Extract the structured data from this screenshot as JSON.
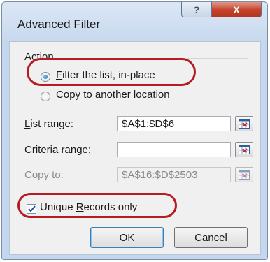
{
  "window": {
    "title": "Advanced Filter",
    "help_label": "?",
    "close_label": "X"
  },
  "action": {
    "group_label": "Action",
    "options": [
      {
        "mnemonic": "F",
        "rest": "ilter the list, in-place",
        "checked": true
      },
      {
        "mnemonic": "o",
        "prefix": "C",
        "rest": "py to another location",
        "checked": false
      }
    ]
  },
  "fields": {
    "list_range": {
      "mnemonic": "L",
      "rest": "ist range:",
      "value": "$A$1:$D$6"
    },
    "criteria_range": {
      "mnemonic": "C",
      "rest": "riteria range:",
      "value": ""
    },
    "copy_to": {
      "label": "Copy to:",
      "value": "$A$16:$D$2503",
      "disabled": true
    }
  },
  "unique_records": {
    "mnemonic": "R",
    "prefix": "Unique ",
    "rest": "ecords only",
    "checked": true
  },
  "buttons": {
    "ok": "OK",
    "cancel": "Cancel"
  },
  "colors": {
    "highlight": "#b51c24",
    "accent": "#1b6fbf",
    "close_button": "#c4402a"
  },
  "icons": {
    "range_picker": "range-select-icon",
    "check": "checkmark-icon"
  }
}
